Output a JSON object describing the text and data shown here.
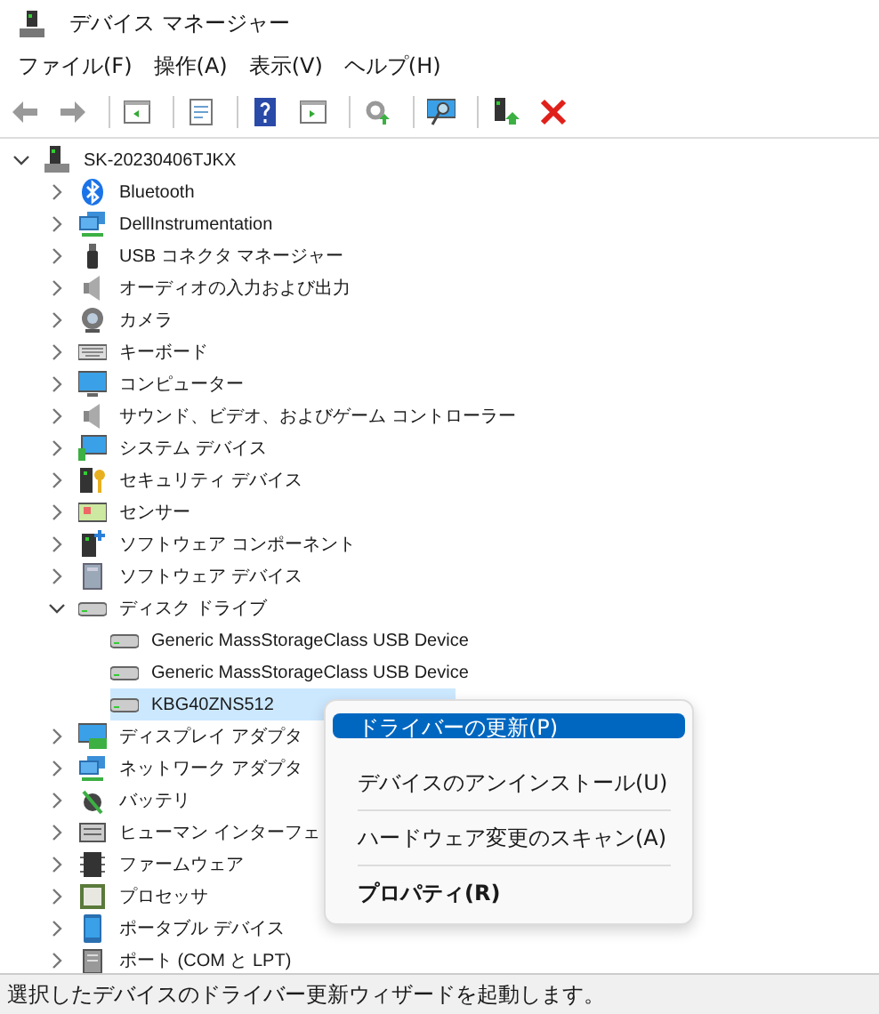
{
  "window": {
    "title": "デバイス マネージャー"
  },
  "menu": [
    "ファイル(F)",
    "操作(A)",
    "表示(V)",
    "ヘルプ(H)"
  ],
  "tree": {
    "label": "SK-20230406TJKX",
    "expanded": true,
    "selected": false,
    "children": [
      {
        "label": "Bluetooth",
        "expanded": false,
        "selected": false
      },
      {
        "label": "DellInstrumentation",
        "expanded": false,
        "selected": false
      },
      {
        "label": "USB コネクタ マネージャー",
        "expanded": false,
        "selected": false
      },
      {
        "label": "オーディオの入力および出力",
        "expanded": false,
        "selected": false
      },
      {
        "label": "カメラ",
        "expanded": false,
        "selected": false
      },
      {
        "label": "キーボード",
        "expanded": false,
        "selected": false
      },
      {
        "label": "コンピューター",
        "expanded": false,
        "selected": false
      },
      {
        "label": "サウンド、ビデオ、およびゲーム コントローラー",
        "expanded": false,
        "selected": false
      },
      {
        "label": "システム デバイス",
        "expanded": false,
        "selected": false
      },
      {
        "label": "セキュリティ デバイス",
        "expanded": false,
        "selected": false
      },
      {
        "label": "センサー",
        "expanded": false,
        "selected": false
      },
      {
        "label": "ソフトウェア コンポーネント",
        "expanded": false,
        "selected": false
      },
      {
        "label": "ソフトウェア デバイス",
        "expanded": false,
        "selected": false
      },
      {
        "label": "ディスク ドライブ",
        "expanded": true,
        "selected": false,
        "children": [
          {
            "label": "Generic MassStorageClass USB Device",
            "selected": false
          },
          {
            "label": "Generic MassStorageClass USB Device",
            "selected": false
          },
          {
            "label": "KBG40ZNS512",
            "selected": true
          }
        ]
      },
      {
        "label": "ディスプレイ アダプタ",
        "expanded": false,
        "selected": false
      },
      {
        "label": "ネットワーク アダプタ",
        "expanded": false,
        "selected": false
      },
      {
        "label": "バッテリ",
        "expanded": false,
        "selected": false
      },
      {
        "label": "ヒューマン インターフェ",
        "expanded": false,
        "selected": false
      },
      {
        "label": "ファームウェア",
        "expanded": false,
        "selected": false
      },
      {
        "label": "プロセッサ",
        "expanded": false,
        "selected": false
      },
      {
        "label": "ポータブル デバイス",
        "expanded": false,
        "selected": false
      },
      {
        "label": "ポート (COM と LPT)",
        "expanded": false,
        "selected": false
      }
    ]
  },
  "context_menu": {
    "groups": [
      [
        {
          "label": "ドライバーの更新(P)",
          "selected": true,
          "default": false
        },
        {
          "label": "デバイスのアンインストール(U)",
          "selected": false,
          "default": false
        }
      ],
      [
        {
          "label": "ハードウェア変更のスキャン(A)",
          "selected": false,
          "default": false
        }
      ],
      [
        {
          "label": "プロパティ(R)",
          "selected": false,
          "default": true
        }
      ]
    ]
  },
  "status_bar": "選択したデバイスのドライバー更新ウィザードを起動します。"
}
